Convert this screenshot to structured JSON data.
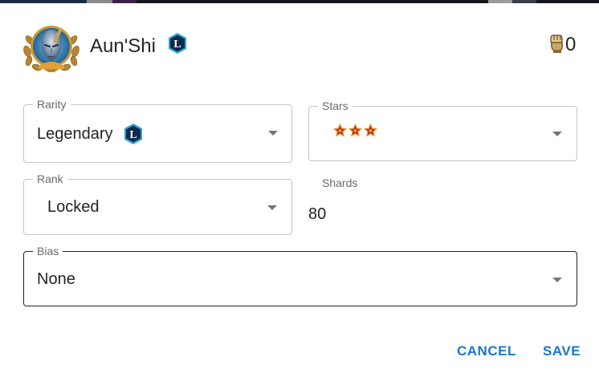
{
  "character": {
    "name": "Aun'Shi",
    "rarity_badge_letter": "L",
    "count": "0"
  },
  "fields": {
    "rarity": {
      "label": "Rarity",
      "value": "Legendary",
      "badge_letter": "L"
    },
    "stars": {
      "label": "Stars",
      "count": 3
    },
    "rank": {
      "label": "Rank",
      "value": "Locked"
    },
    "shards": {
      "label": "Shards",
      "value": "80"
    },
    "bias": {
      "label": "Bias",
      "value": "None"
    }
  },
  "actions": {
    "cancel_label": "CANCEL",
    "save_label": "SAVE"
  },
  "colors": {
    "accent": "#1976d2",
    "legendary_badge": "#0b2b4a",
    "legendary_glow": "#2aa9e0",
    "star_red": "#c0251d",
    "star_gold": "#e2a33a"
  }
}
